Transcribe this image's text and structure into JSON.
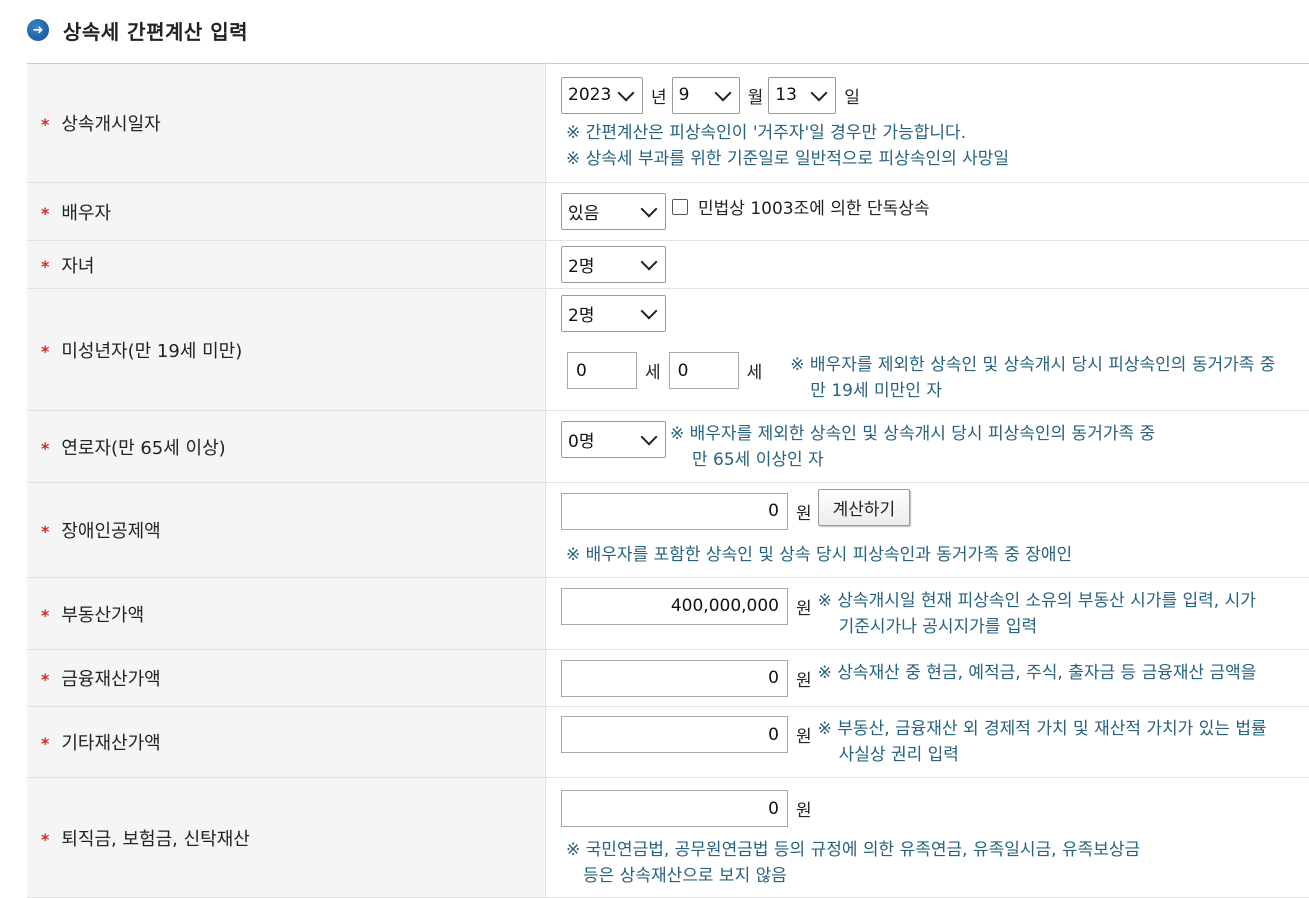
{
  "header": {
    "title": "상속세 간편계산 입력",
    "icon": "arrow-circle-icon"
  },
  "rows": {
    "start_date": {
      "label": "상속개시일자",
      "year": "2023",
      "year_unit": "년",
      "month": "9",
      "month_unit": "월",
      "day": "13",
      "day_unit": "일",
      "note1": "※ 간편계산은 피상속인이 '거주자'일 경우만 가능합니다.",
      "note2": "※ 상속세 부과를 위한 기준일로 일반적으로 피상속인의 사망일"
    },
    "spouse": {
      "label": "배우자",
      "select": "있음",
      "checkbox_label": "민법상 1003조에 의한 단독상속",
      "checked": false
    },
    "children": {
      "label": "자녀",
      "select": "2명"
    },
    "minors": {
      "label": "미성년자(만 19세 미만)",
      "select": "2명",
      "age1": "0",
      "age1_unit": "세",
      "age2": "0",
      "age2_unit": "세",
      "note1": "※ 배우자를 제외한 상속인 및 상속개시 당시 피상속인의 동거가족 중",
      "note2": "만 19세 미만인 자"
    },
    "elderly": {
      "label": "연로자(만 65세 이상)",
      "select": "0명",
      "note1": "※ 배우자를 제외한 상속인 및 상속개시 당시 피상속인의 동거가족 중",
      "note2": "만 65세 이상인 자"
    },
    "disabled": {
      "label": "장애인공제액",
      "value": "0",
      "unit": "원",
      "button": "계산하기",
      "note": "※ 배우자를 포함한 상속인 및 상속 당시 피상속인과 동거가족 중 장애인"
    },
    "real_estate": {
      "label": "부동산가액",
      "value": "400,000,000",
      "unit": "원",
      "note1": "※ 상속개시일 현재 피상속인 소유의 부동산 시가를 입력, 시가",
      "note2": "기준시가나 공시지가를 입력"
    },
    "financial": {
      "label": "금융재산가액",
      "value": "0",
      "unit": "원",
      "note1": "※ 상속재산 중 현금, 예적금, 주식, 출자금 등 금융재산 금액을"
    },
    "other": {
      "label": "기타재산가액",
      "value": "0",
      "unit": "원",
      "note1": "※ 부동산, 금융재산 외 경제적 가치 및 재산적 가치가 있는 법률",
      "note2": "사실상 권리 입력"
    },
    "retirement": {
      "label": "퇴직금, 보험금, 신탁재산",
      "value": "0",
      "unit": "원",
      "note1": "※ 국민연금법, 공무원연금법 등의 규정에 의한 유족연금, 유족일시금, 유족보상금",
      "note2": "등은 상속재산으로 보지 않음"
    }
  }
}
